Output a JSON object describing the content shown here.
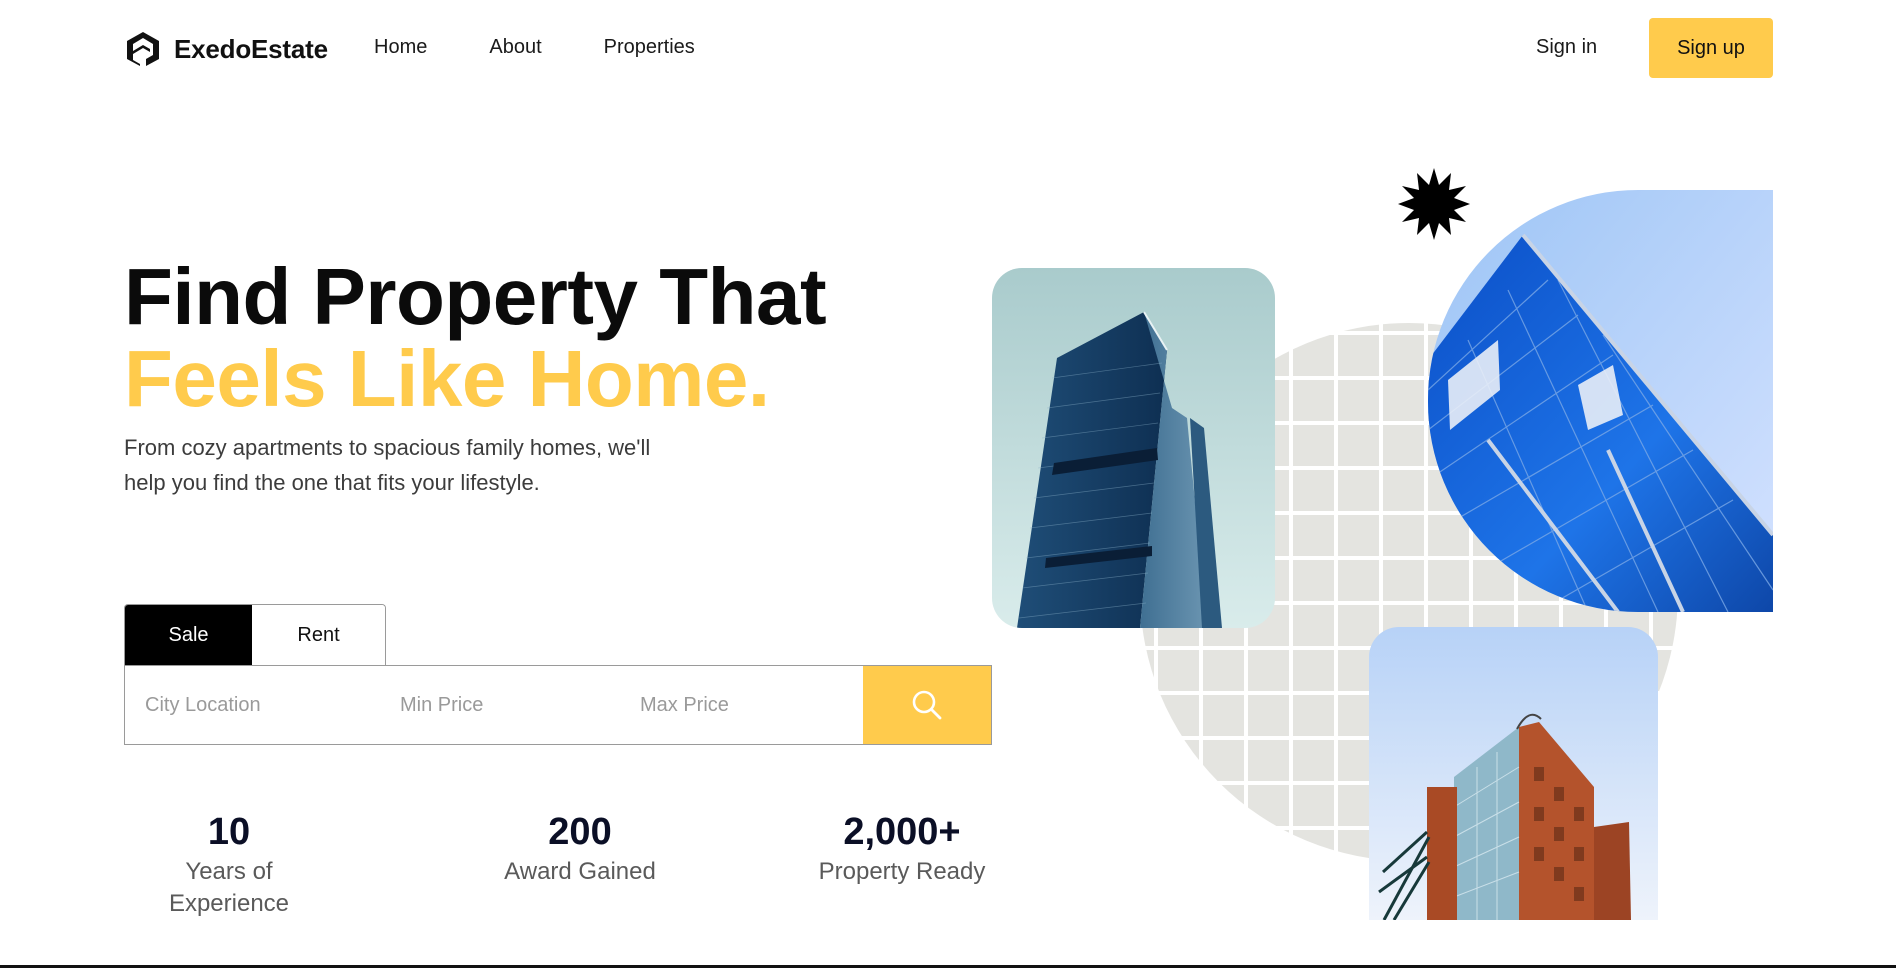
{
  "brand": {
    "name": "ExedoEstate",
    "accent": "#FFCB4C"
  },
  "nav": {
    "links": [
      "Home",
      "About",
      "Properties"
    ],
    "signin": "Sign in",
    "signup": "Sign up"
  },
  "hero": {
    "title_line1": "Find Property That",
    "title_line2": "Feels Like Home.",
    "subtitle": "From cozy apartments to spacious family homes, we'll help you find the one that fits your lifestyle."
  },
  "search": {
    "tabs": [
      "Sale",
      "Rent"
    ],
    "active_tab": "Sale",
    "city_placeholder": "City Location",
    "min_placeholder": "Min Price",
    "max_placeholder": "Max Price",
    "button_icon": "search-icon"
  },
  "stats": [
    {
      "value": "10",
      "label": "Years of Experience"
    },
    {
      "value": "200",
      "label": "Award Gained"
    },
    {
      "value": "2,000+",
      "label": "Property Ready"
    }
  ]
}
